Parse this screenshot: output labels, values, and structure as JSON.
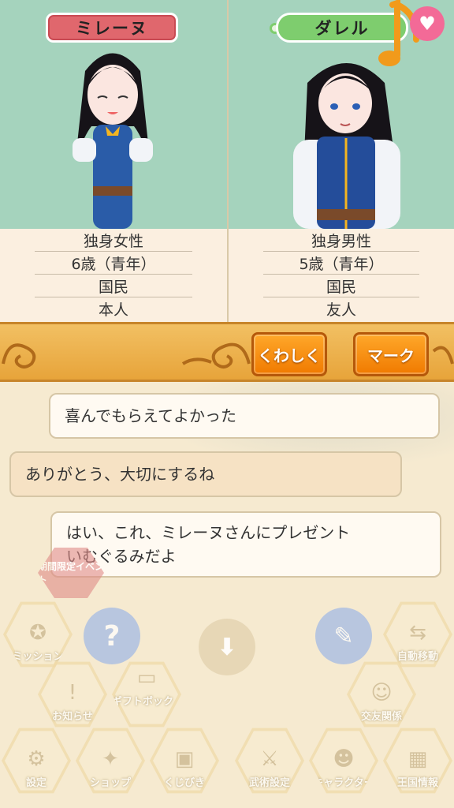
{
  "left_character": {
    "name": "ミレーヌ",
    "info": [
      "独身女性",
      "6歳（青年）",
      "国民",
      "本人"
    ]
  },
  "right_character": {
    "name": "ダレル",
    "info": [
      "独身男性",
      "5歳（青年）",
      "国民",
      "友人"
    ]
  },
  "buttons": {
    "details": "くわしく",
    "mark": "マーク"
  },
  "dialogue": [
    "喜んでもらえてよかった",
    "ありがとう、大切にするね",
    "はい、これ、ミレーヌさんにプレゼント",
    "いむぐるみだよ"
  ],
  "menu": {
    "event_badge": "期間限定イベント",
    "mission": "ミッション",
    "auto_move": "自動移動",
    "news": "お知らせ",
    "gift_box": "ギフトボックス",
    "friendship": "交友関係",
    "settings": "設定",
    "shop": "ショップ",
    "lottery": "くじびき",
    "weapon_settings": "武術設定",
    "character": "キャラクター",
    "kingdom_info": "王国情報"
  },
  "colors": {
    "panel_bg": "#a5d3bd",
    "left_name_tag": "#e0676d",
    "right_name_tag": "#7ecd6e",
    "button_orange": "#f07a00",
    "heart": "#f36a97"
  },
  "icons": {
    "note": "music-note-icon",
    "heart": "heart-icon"
  }
}
